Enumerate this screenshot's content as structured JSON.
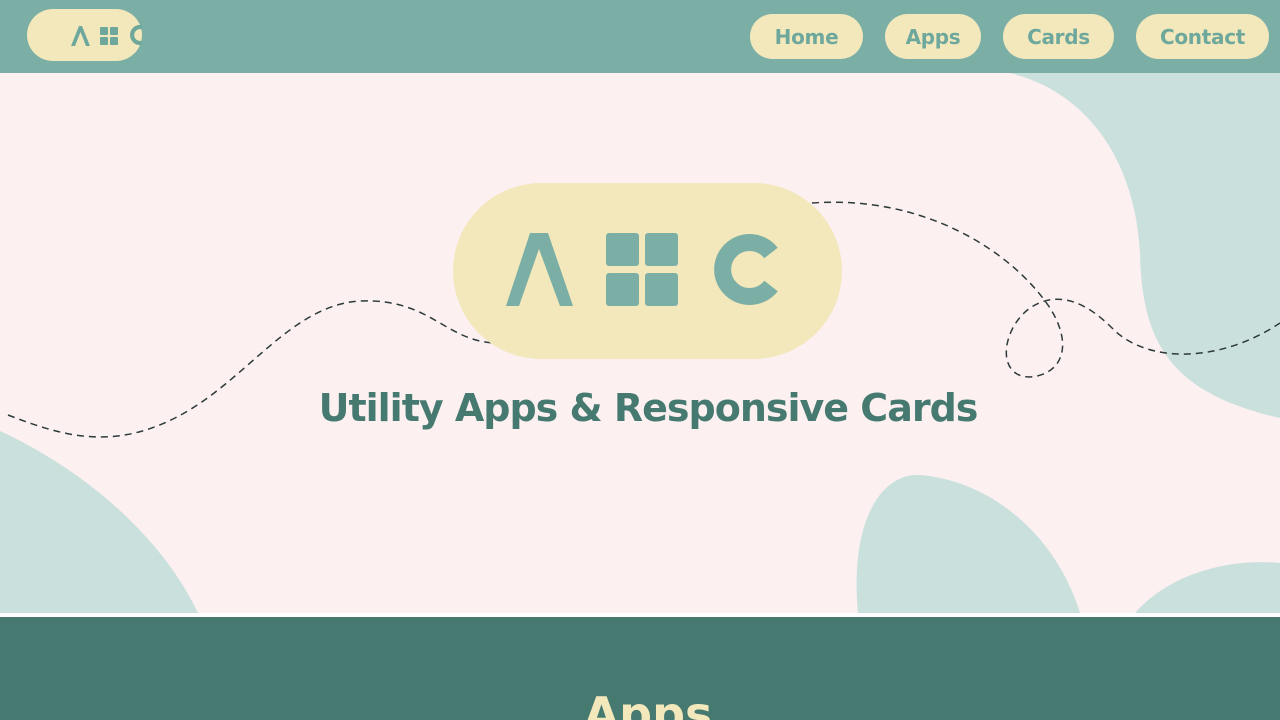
{
  "header": {
    "logo_label": "A·C",
    "nav": [
      {
        "label": "Home"
      },
      {
        "label": "Apps"
      },
      {
        "label": "Cards"
      },
      {
        "label": "Contact"
      }
    ]
  },
  "hero": {
    "title": "Utility Apps & Responsive Cards"
  },
  "apps_section": {
    "heading": "Apps"
  },
  "colors": {
    "header_bg": "#7bafa6",
    "pill": "#f3e8bb",
    "pill_text": "#6ea89d",
    "hero_bg": "#fcf0f1",
    "blob": "#c9e0dc",
    "title": "#467a71",
    "section_bg": "#467a71",
    "section_heading": "#f3e8bb"
  },
  "icons": [
    "lambda-icon",
    "grid-icon",
    "c-letter-icon"
  ]
}
